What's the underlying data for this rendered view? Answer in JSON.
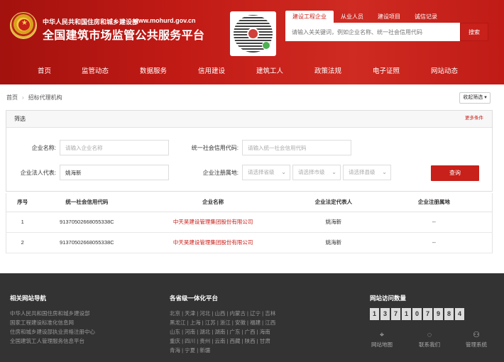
{
  "header": {
    "ministry": "中华人民共和国住房和城乡建设部",
    "site_url": "www.mohurd.gov.cn",
    "platform_title": "全国建筑市场监管公共服务平台"
  },
  "search": {
    "tabs": [
      "建设工程企业",
      "从业人员",
      "建设项目",
      "诚信记录"
    ],
    "placeholder": "请输入关关键词，例如企业名称、统一社会信用代码",
    "button": "搜索"
  },
  "nav": [
    "首页",
    "监管动态",
    "数据服务",
    "信用建设",
    "建筑工人",
    "政策法规",
    "电子证照",
    "网站动态"
  ],
  "breadcrumb": {
    "home": "首页",
    "current": "招标代理机构"
  },
  "collapse_label": "收起筛选",
  "filter": {
    "title": "筛选",
    "more": "更多条件",
    "company_label": "企业名称:",
    "company_placeholder": "请输入企业名称",
    "credit_label": "统一社会信用代码:",
    "credit_placeholder": "请输入统一社会信用代码",
    "legal_label": "企业法人代表:",
    "legal_value": "姚海新",
    "region_label": "企业注册属地:",
    "province_placeholder": "请选择省级",
    "city_placeholder": "请选择市级",
    "county_placeholder": "请选择县级",
    "query_button": "查询"
  },
  "table": {
    "headers": [
      "序号",
      "统一社会信用代码",
      "企业名称",
      "企业法定代表人",
      "企业注册属地"
    ],
    "rows": [
      {
        "no": "1",
        "code": "913705026680553З8С",
        "name": "中天昊建设管理集团股份有限公司",
        "legal": "姚海新",
        "region": "--"
      },
      {
        "no": "2",
        "code": "913705026680553З8С",
        "name": "中天昊建设管理集团股份有限公司",
        "legal": "姚海新",
        "region": "--"
      }
    ]
  },
  "footer": {
    "nav_title": "相关网站导航",
    "links": [
      "中华人民共和国住房和城乡建设部",
      "国家工程建设标准化信息网",
      "住房和城乡建设部执业资格注册中心",
      "全国建筑工人管理服务信息平台"
    ],
    "provinces_title": "各省级一体化平台",
    "province_lines": [
      "北京 | 天津 | 河北 | 山西 | 内蒙古 | 辽宁 | 吉林",
      "黑龙江 | 上海 | 江苏 | 浙江 | 安徽 | 福建 | 江西",
      "山东 | 河南 | 湖北 | 湖南 | 广东 | 广西 | 海南",
      "重庆 | 四川 | 贵州 | 云南 | 西藏 | 陕西 | 甘肃",
      "青海 | 宁夏 | 新疆"
    ],
    "visits_title": "网站访问数量",
    "visit_digits": [
      "1",
      "3",
      "7",
      "1",
      "0",
      "7",
      "9",
      "8",
      "4"
    ],
    "tools": [
      "网站地图",
      "联系我们",
      "管理系统"
    ]
  }
}
